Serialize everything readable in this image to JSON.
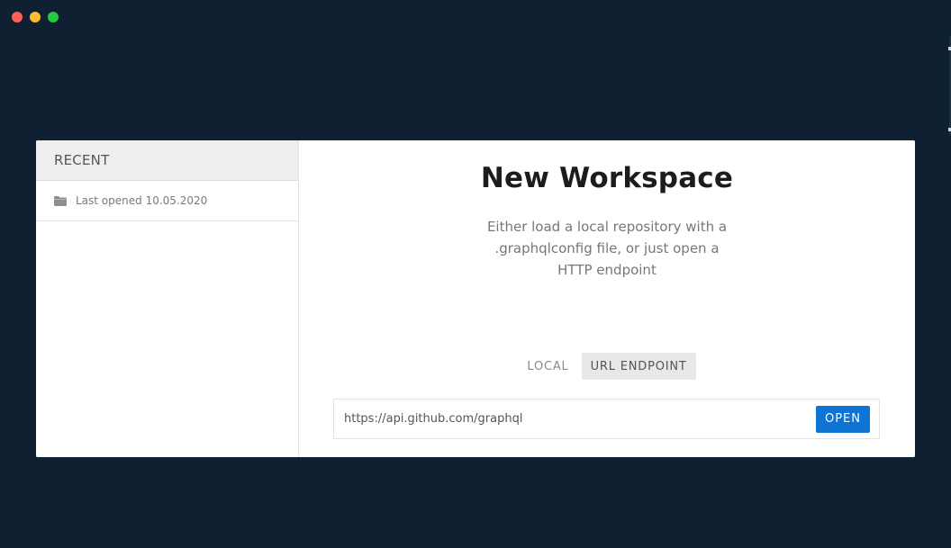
{
  "colors": {
    "background": "#0f2033",
    "accent": "#0d74d4",
    "close": "#ff5f57",
    "minimize": "#febc2e",
    "maximize": "#28c840"
  },
  "sidebar": {
    "header": "RECENT",
    "items": [
      {
        "icon": "folder-icon",
        "label": "Last opened 10.05.2020"
      }
    ]
  },
  "main": {
    "title": "New Workspace",
    "subtitle": "Either load a local repository with a .graphqlconfig file, or just open a HTTP endpoint",
    "tabs": [
      {
        "label": "LOCAL",
        "active": false
      },
      {
        "label": "URL ENDPOINT",
        "active": true
      }
    ],
    "url_input": {
      "value": "https://api.github.com/graphql",
      "placeholder": ""
    },
    "open_label": "OPEN"
  }
}
